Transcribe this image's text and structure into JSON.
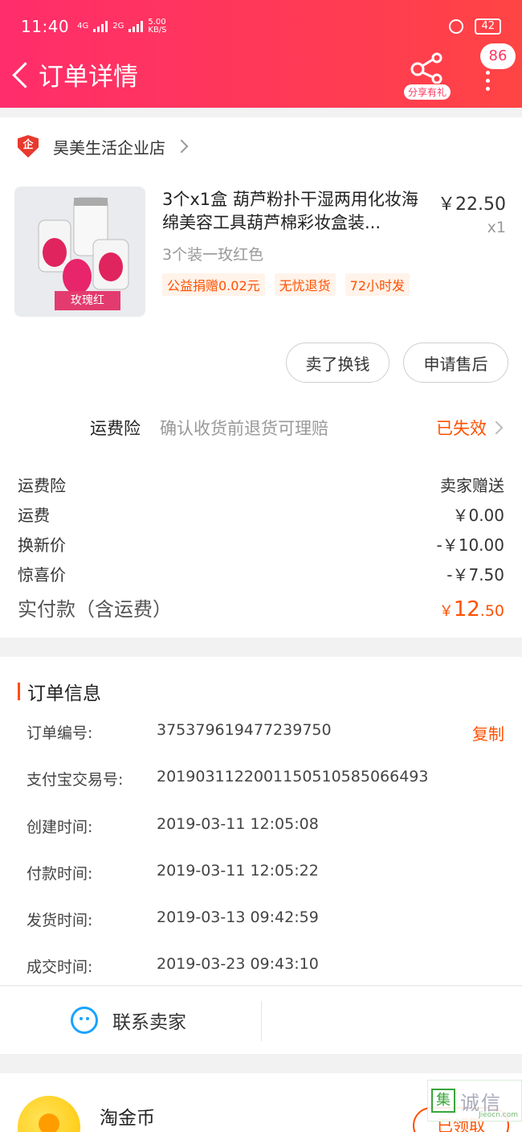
{
  "status_bar": {
    "time": "11:40",
    "net_a": "4G",
    "net_b": "2G",
    "speed_value": "5.00",
    "speed_unit": "KB/S",
    "battery": "42"
  },
  "header": {
    "title": "订单详情",
    "share_label": "分享有礼",
    "message_count": "86"
  },
  "shop": {
    "badge": "企",
    "name": "昊美生活企业店"
  },
  "product": {
    "image_tag": "玫瑰红",
    "title": "3个x1盒 葫芦粉扑干湿两用化妆海绵美容工具葫芦棉彩妆盒装...",
    "price": "￥22.50",
    "quantity": "x1",
    "sku": "3个装一玫红色",
    "badges": [
      "公益捐赠0.02元",
      "无忧退货",
      "72小时发"
    ]
  },
  "actions": {
    "sell_label": "卖了换钱",
    "after_sale_label": "申请售后"
  },
  "insurance": {
    "name": "运费险",
    "desc": "确认收货前退货可理赔",
    "status": "已失效"
  },
  "fees": [
    {
      "label": "运费险",
      "value": "卖家赠送"
    },
    {
      "label": "运费",
      "value": "￥0.00"
    },
    {
      "label": "换新价",
      "value": "-￥10.00"
    },
    {
      "label": "惊喜价",
      "value": "-￥7.50"
    }
  ],
  "total": {
    "label": "实付款（含运费）",
    "currency": "￥",
    "integer": "12",
    "decimal": ".50"
  },
  "order_info": {
    "title": "订单信息",
    "copy_label": "复制",
    "rows": [
      {
        "label": "订单编号:",
        "value": "375379619477239750"
      },
      {
        "label": "支付宝交易号:",
        "value": "2019031122001150510585066493"
      },
      {
        "label": "创建时间:",
        "value": "2019-03-11 12:05:08"
      },
      {
        "label": "付款时间:",
        "value": "2019-03-11 12:05:22"
      },
      {
        "label": "发货时间:",
        "value": "2019-03-13 09:42:59"
      },
      {
        "label": "成交时间:",
        "value": "2019-03-23 09:43:10"
      }
    ],
    "contact_label": "联系卖家"
  },
  "coin": {
    "name": "淘金币",
    "button": "已领取"
  },
  "watermark": {
    "mark": "集",
    "text": "诚信",
    "url": "Jieocn.com"
  },
  "colors": {
    "header_gradient_start": "#ff2d6b",
    "header_gradient_end": "#ff4444",
    "accent": "#ff5000"
  }
}
